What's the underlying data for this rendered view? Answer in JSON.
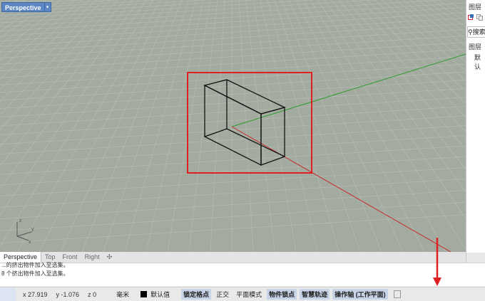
{
  "viewport": {
    "title": "Perspective",
    "dropdown_glyph": "▾"
  },
  "right_panel": {
    "title": "图层",
    "icons": [
      "new-layer-icon",
      "copy-layer-icon"
    ],
    "search_placeholder": "搜索",
    "header": "图层",
    "layer_row": "默认"
  },
  "tabs": {
    "items": [
      "Perspective",
      "Top",
      "Front",
      "Right"
    ],
    "add_glyph": "✣"
  },
  "command": {
    "line1": "...的挤出物件加入至选集。",
    "line2": "8 个挤出物件加入至选集。"
  },
  "status": {
    "x": "x 27.919",
    "y": "y -1.076",
    "z": "z 0",
    "units": "毫米",
    "layer_swatch_color": "#000000",
    "layer": "默认值",
    "toggles": [
      {
        "label": "锁定格点",
        "on": true
      },
      {
        "label": "正交",
        "on": false
      },
      {
        "label": "平面模式",
        "on": false
      },
      {
        "label": "物件锁点",
        "on": true
      },
      {
        "label": "智慧轨迹",
        "on": true
      },
      {
        "label": "操作轴 (工作平面)",
        "on": true
      }
    ]
  },
  "colors": {
    "viewport_bg": "#a3aba0",
    "grid_line": "#b3bab0",
    "axis_x": "#c62828",
    "axis_y": "#2e9a2e",
    "highlight_box": "#e02020",
    "active_tab": "#5d87c2",
    "arrow": "#e02020"
  }
}
